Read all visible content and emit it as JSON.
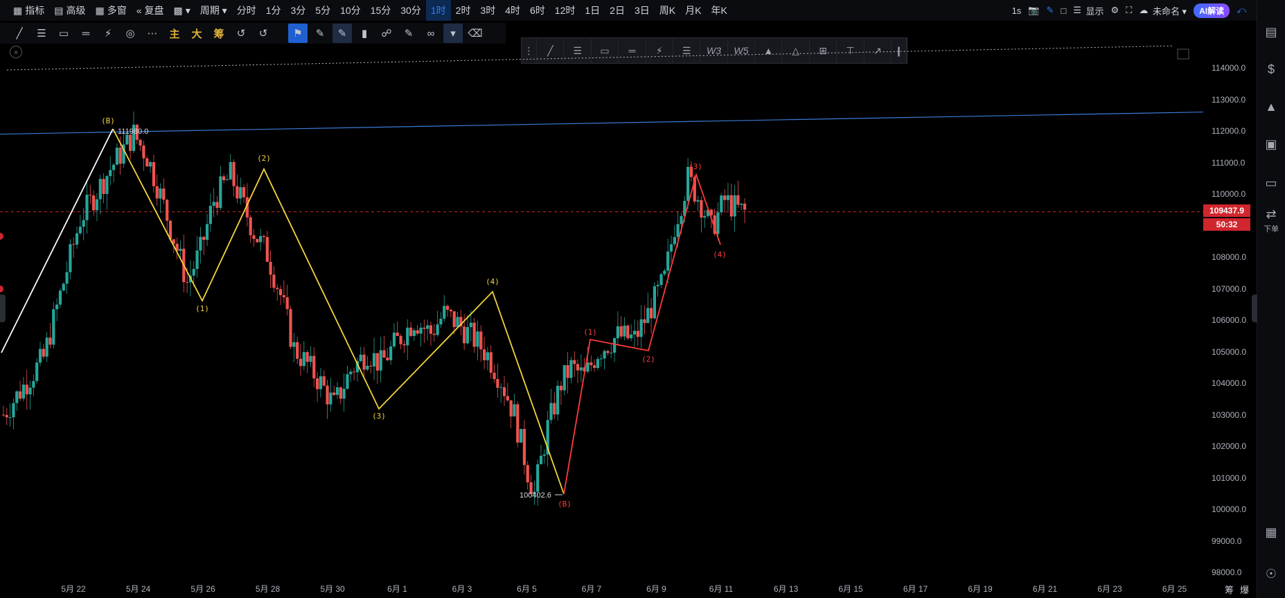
{
  "topbar": {
    "items": [
      {
        "icon": "indicator-icon",
        "label": "指标"
      },
      {
        "icon": "advanced-icon",
        "label": "高级"
      },
      {
        "icon": "multi-window-icon",
        "label": "多窗"
      },
      {
        "icon": "replay-icon",
        "label": "复盘"
      },
      {
        "icon": "chart-type-icon",
        "label": "▾"
      },
      {
        "icon": "",
        "label": "周期 ▾"
      }
    ],
    "periods": [
      "分时",
      "1分",
      "3分",
      "5分",
      "10分",
      "15分",
      "30分",
      "1时",
      "2时",
      "3时",
      "4时",
      "6时",
      "12时",
      "1日",
      "2日",
      "3日",
      "周K",
      "月K",
      "年K"
    ],
    "active_period": "1时",
    "right": {
      "interval": "1s",
      "display": "显示",
      "workspace": "未命名 ▾",
      "ai_button": "AI解读"
    }
  },
  "drawbar": {
    "tools": [
      "line-tool-icon",
      "horizontal-lines-icon",
      "rectangle-icon",
      "channel-icon",
      "fib-icon",
      "spiral-icon",
      "more-icon"
    ],
    "text_tools": [
      "主",
      "大",
      "筹"
    ],
    "right_tools": [
      "magnet-tool-icon",
      "measure-icon",
      "pen-tool-icon",
      "candles-icon",
      "lock-icon",
      "edit-icon",
      "link-icon",
      "filter-icon",
      "trash-icon"
    ]
  },
  "floatbar": {
    "tools": [
      "drag-handle-icon",
      "trend-line-icon",
      "parallel-lines-icon",
      "rectangle-icon",
      "ruler-icon",
      "pitchfork-icon",
      "fib-retracement-icon",
      "wave-w3-icon",
      "wave-w5-icon",
      "pattern-icon",
      "triangle-icon",
      "add-icon",
      "text-icon",
      "arrow-icon",
      "collapse-icon"
    ],
    "wave_labels": [
      "W3",
      "W5"
    ]
  },
  "right_sidebar": {
    "items": [
      {
        "icon": "notes-icon",
        "label": ""
      },
      {
        "icon": "price-list-icon",
        "label": ""
      },
      {
        "icon": "trend-icon",
        "label": ""
      },
      {
        "icon": "monitor-icon",
        "label": ""
      },
      {
        "icon": "window-icon",
        "label": ""
      },
      {
        "icon": "order-icon",
        "label": "下单"
      },
      {
        "icon": "layout-icon",
        "label": ""
      },
      {
        "icon": "headset-icon",
        "label": ""
      }
    ]
  },
  "yaxis": {
    "ticks": [
      "114000.0",
      "113000.0",
      "112000.0",
      "111000.0",
      "110000.0",
      "109000.0",
      "108000.0",
      "107000.0",
      "106000.0",
      "105000.0",
      "104000.0",
      "103000.0",
      "102000.0",
      "101000.0",
      "100000.0",
      "99000.0",
      "98000.0"
    ],
    "current_price": "109437.9",
    "countdown": "50:32",
    "price_color": "#d0262d"
  },
  "xaxis": {
    "ticks": [
      "5月 22",
      "5月 24",
      "5月 26",
      "5月 28",
      "5月 30",
      "6月 1",
      "6月 3",
      "6月 5",
      "6月 7",
      "6月 9",
      "6月 11",
      "6月 13",
      "6月 15",
      "6月 17",
      "6月 19",
      "6月 21",
      "6月 23",
      "6月 25"
    ],
    "end_labels": [
      "筹",
      "爆"
    ]
  },
  "chart_data": {
    "type": "candlestick-with-elliott-waves",
    "timeframe": "1时",
    "ylim": [
      97500,
      114700
    ],
    "annotations": {
      "high_price": "111980.0",
      "low_price": "100402.6"
    },
    "yellow_wave": {
      "color": "#f5d53b",
      "labels": [
        "(B)",
        "(1)",
        "(2)",
        "(3)",
        "(4)"
      ],
      "points": [
        [
          5.2,
          111980
        ],
        [
          5.6,
          106600
        ],
        [
          6.0,
          110700
        ],
        [
          6.7,
          103100
        ],
        [
          7.5,
          106800
        ],
        [
          8.1,
          100400
        ]
      ]
    },
    "red_wave": {
      "color": "#ff3b3b",
      "labels": [
        "(B)",
        "(1)",
        "(2)",
        "(3)",
        "(4)"
      ],
      "points": [
        [
          8.1,
          100400
        ],
        [
          8.5,
          105300
        ],
        [
          9.05,
          105000
        ],
        [
          9.6,
          110550
        ],
        [
          9.95,
          108400
        ]
      ]
    },
    "white_line": {
      "color": "#ffffff",
      "points": [
        [
          0,
          102800
        ],
        [
          5.2,
          111980
        ]
      ]
    },
    "blue_trendline": {
      "color": "#3a7bd5",
      "points": [
        [
          0,
          111900
        ],
        [
          18.5,
          112600
        ]
      ]
    },
    "dotted_line": {
      "color": "#bbbbbb",
      "points": [
        [
          0,
          114000
        ],
        [
          18,
          114700
        ]
      ]
    },
    "current_price_line": 109437.9,
    "candle_colors": {
      "up": "#26a69a",
      "down": "#ef5350"
    }
  }
}
